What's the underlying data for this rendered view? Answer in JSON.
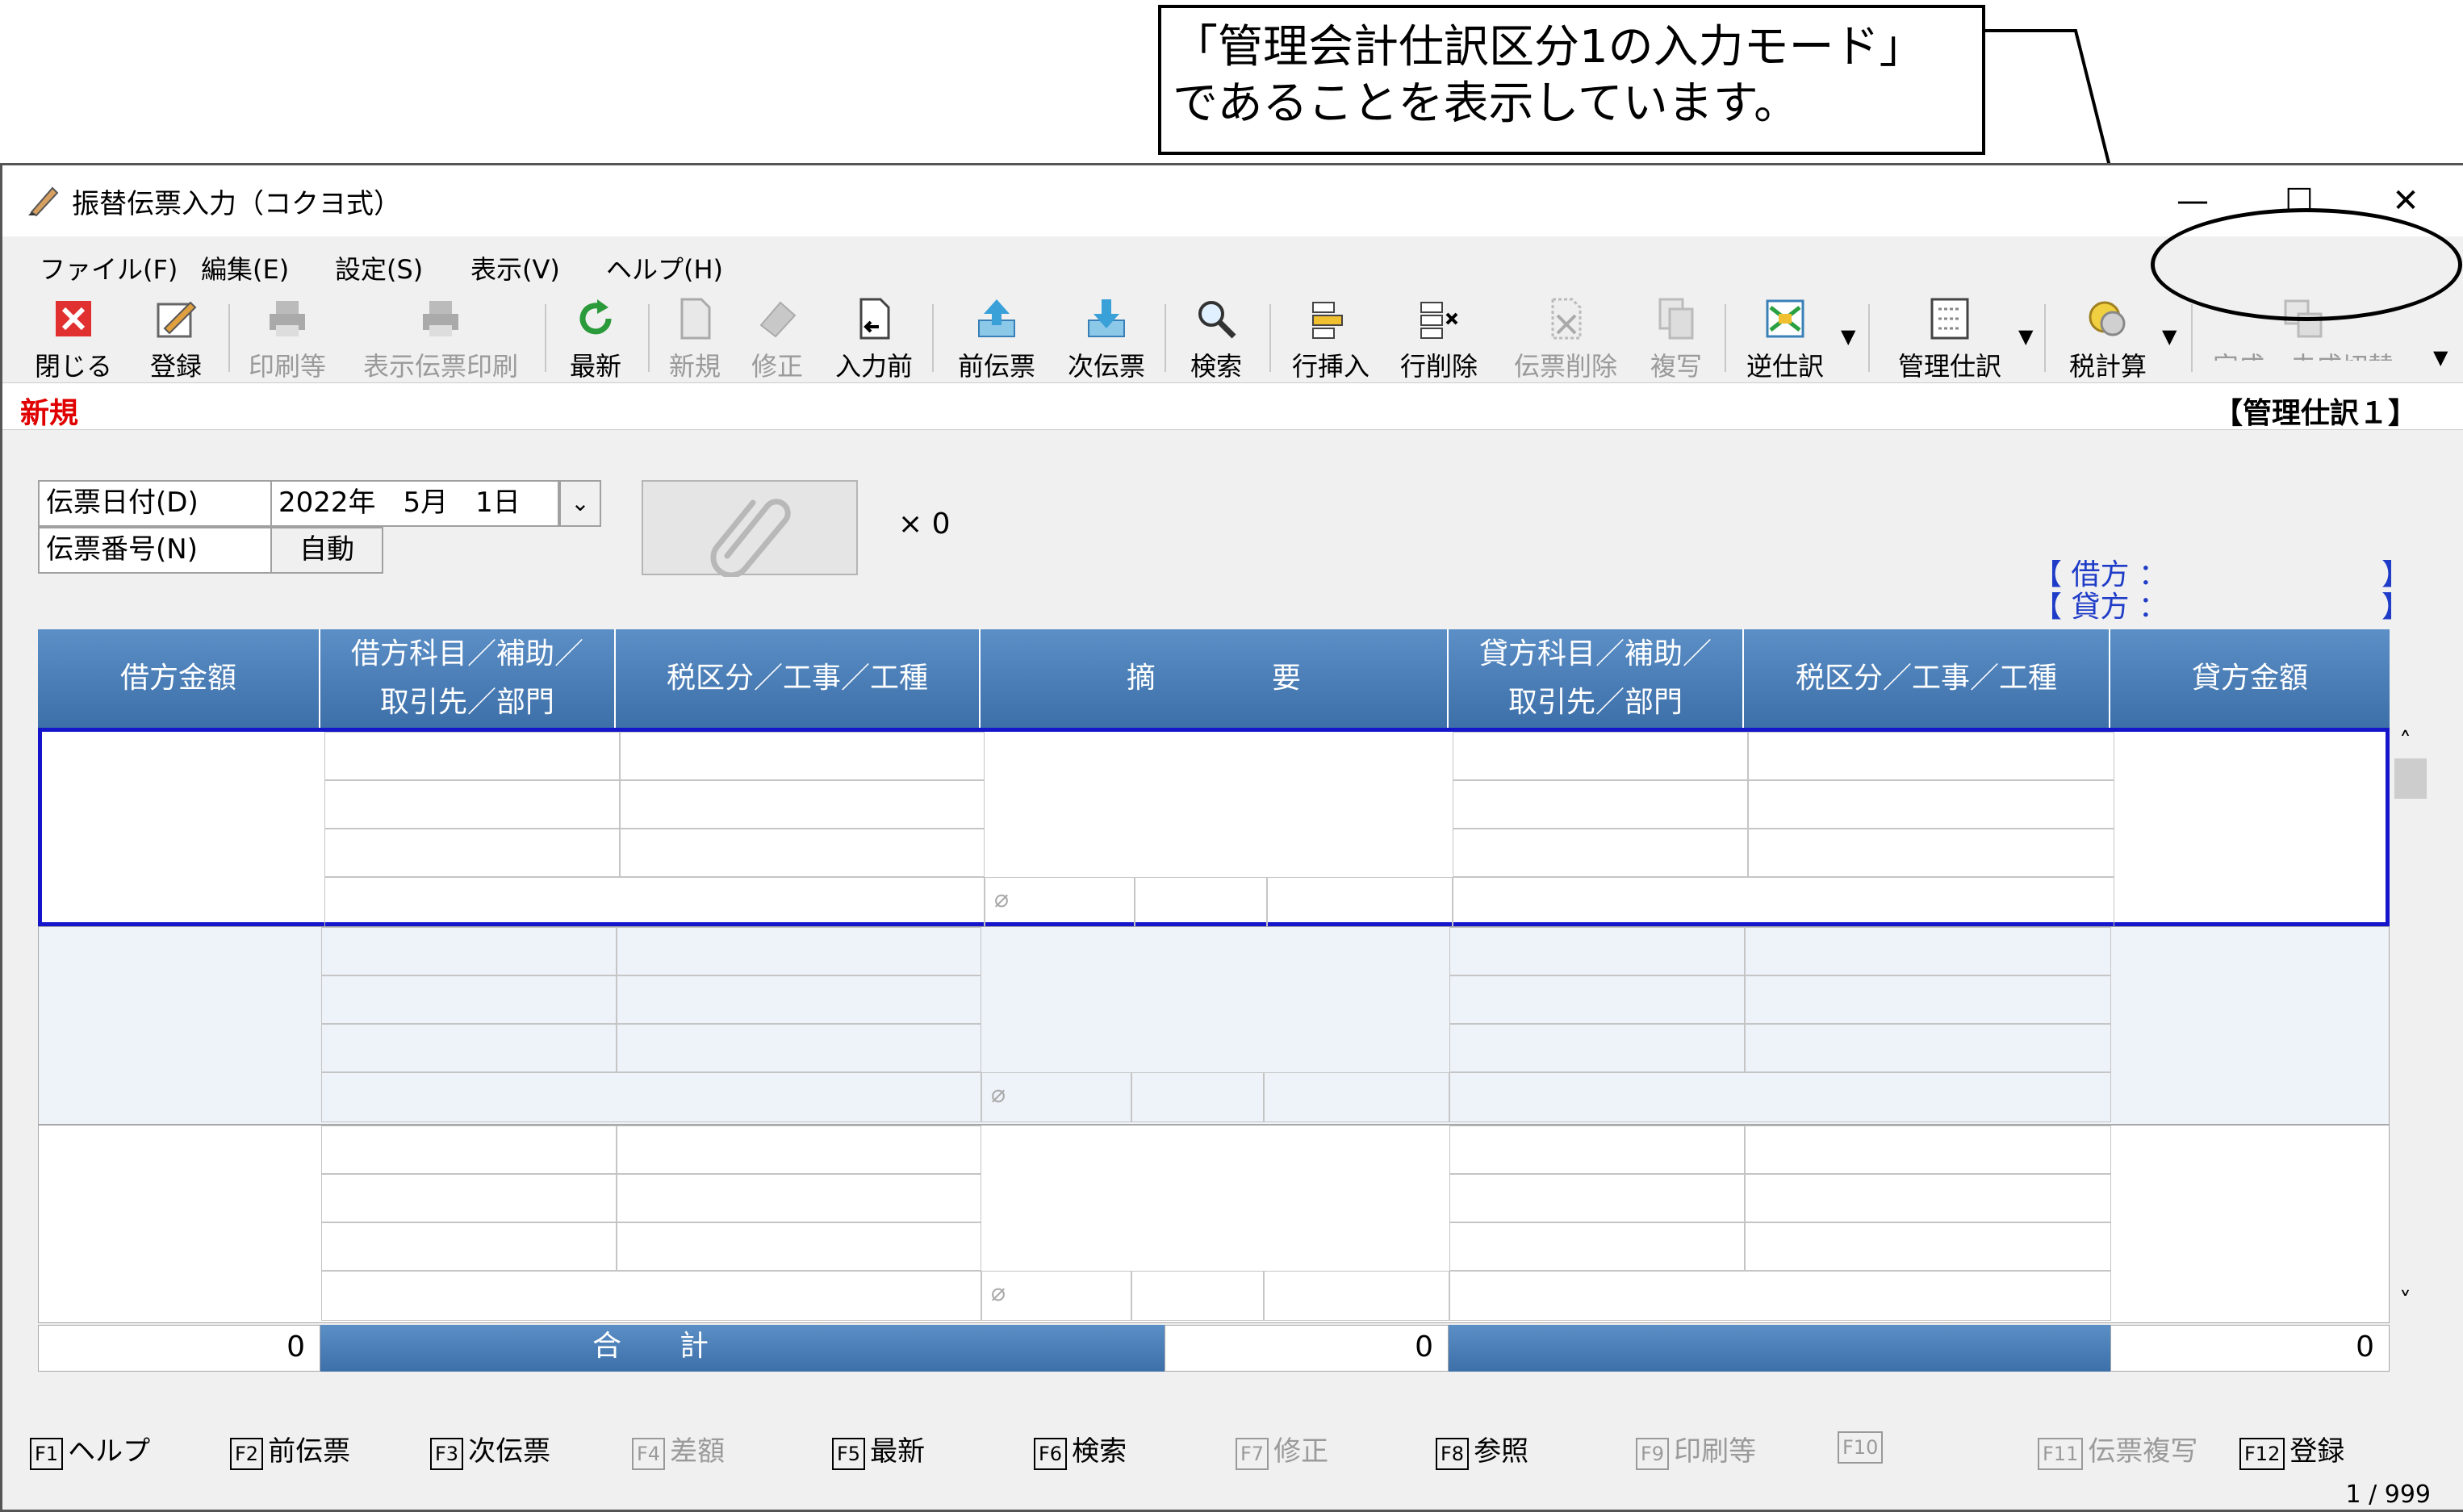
{
  "callout": {
    "line1": "「管理会計仕訳区分1の入力モード」",
    "line2": "であることを表示しています。"
  },
  "window": {
    "title": "振替伝票入力（コクヨ式）",
    "minimize": "—",
    "maximize": "☐",
    "close": "✕"
  },
  "menu": [
    "ファイル(F)",
    "編集(E)",
    "設定(S)",
    "表示(V)",
    "ヘルプ(H)"
  ],
  "toolbar": [
    {
      "label": "閉じる",
      "icon": "close-doc-icon",
      "enabled": true
    },
    {
      "label": "登録",
      "icon": "register-icon",
      "enabled": true
    },
    {
      "label": "印刷等",
      "icon": "printer-icon",
      "enabled": false
    },
    {
      "label": "表示伝票印刷",
      "icon": "printer-icon",
      "enabled": false
    },
    {
      "label": "最新",
      "icon": "refresh-icon",
      "enabled": true
    },
    {
      "label": "新規",
      "icon": "new-doc-icon",
      "enabled": false
    },
    {
      "label": "修正",
      "icon": "eraser-icon",
      "enabled": false
    },
    {
      "label": "入力前",
      "icon": "undo-doc-icon",
      "enabled": true
    },
    {
      "label": "前伝票",
      "icon": "prev-slip-icon",
      "enabled": true
    },
    {
      "label": "次伝票",
      "icon": "next-slip-icon",
      "enabled": true
    },
    {
      "label": "検索",
      "icon": "magnifier-icon",
      "enabled": true
    },
    {
      "label": "行挿入",
      "icon": "insert-row-icon",
      "enabled": true
    },
    {
      "label": "行削除",
      "icon": "delete-row-icon",
      "enabled": true
    },
    {
      "label": "伝票削除",
      "icon": "delete-slip-icon",
      "enabled": false
    },
    {
      "label": "複写",
      "icon": "copy-icon",
      "enabled": false
    },
    {
      "label": "逆仕訳",
      "icon": "reverse-journal-icon",
      "enabled": true
    },
    {
      "label": "管理仕訳",
      "icon": "mgmt-journal-icon",
      "enabled": true
    },
    {
      "label": "税計算",
      "icon": "tax-calc-icon",
      "enabled": true
    },
    {
      "label": "完成・未成切替",
      "icon": "toggle-icon",
      "enabled": false
    }
  ],
  "status": {
    "mode": "新規",
    "journal_mode": "【管理仕訳１】"
  },
  "form": {
    "date_label": "伝票日付(D)",
    "date_value": "2022年　5月　1日",
    "number_label": "伝票番号(N)",
    "number_value": "自動",
    "attach_count": "× 0"
  },
  "balance": {
    "debit": "【 借方 ：",
    "credit": "【 貸方 ：",
    "close1": "】",
    "close2": "】"
  },
  "columns": {
    "debit_amount": "借方金額",
    "debit_account_1": "借方科目／補助／",
    "debit_account_2": "取引先／部門",
    "debit_tax": "税区分／工事／工種",
    "summary": "摘　　　　要",
    "credit_account_1": "貸方科目／補助／",
    "credit_account_2": "取引先／部門",
    "credit_tax": "税区分／工事／工種",
    "credit_amount": "貸方金額"
  },
  "totals": {
    "debit": "0",
    "label": "合　　計",
    "mid": "0",
    "credit": "0"
  },
  "fkeys": [
    {
      "key": "F1",
      "label": "ヘルプ",
      "enabled": true
    },
    {
      "key": "F2",
      "label": "前伝票",
      "enabled": true
    },
    {
      "key": "F3",
      "label": "次伝票",
      "enabled": true
    },
    {
      "key": "F4",
      "label": "差額",
      "enabled": false
    },
    {
      "key": "F5",
      "label": "最新",
      "enabled": true
    },
    {
      "key": "F6",
      "label": "検索",
      "enabled": true
    },
    {
      "key": "F7",
      "label": "修正",
      "enabled": false
    },
    {
      "key": "F8",
      "label": "参照",
      "enabled": true
    },
    {
      "key": "F9",
      "label": "印刷等",
      "enabled": false
    },
    {
      "key": "F10",
      "label": "",
      "enabled": false
    },
    {
      "key": "F11",
      "label": "伝票複写",
      "enabled": false
    },
    {
      "key": "F12",
      "label": "登録",
      "enabled": true
    }
  ],
  "pager": "1 / 999"
}
